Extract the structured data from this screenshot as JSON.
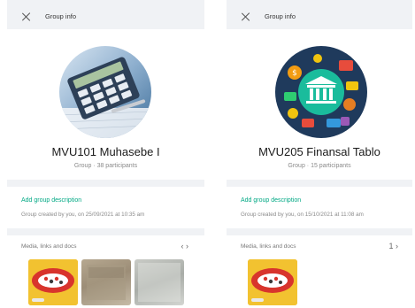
{
  "colors": {
    "accent": "#00a884",
    "panel_bg": "#f0f2f5",
    "card_bg": "#ffffff"
  },
  "panels": [
    {
      "header_title": "Group info",
      "group_name": "MVU101 Muhasebe I",
      "group_meta": "Group · 38 participants",
      "add_description": "Add group description",
      "created_by": "Group created by you, on 25/09/2021 at 10:35 am",
      "media_label": "Media, links and docs",
      "media_nav": "‹ ›",
      "icons": [
        "close-icon",
        "calculator-avatar"
      ]
    },
    {
      "header_title": "Group info",
      "group_name": "MVU205 Finansal Tablo",
      "group_meta": "Group · 15 participants",
      "add_description": "Add group description",
      "created_by": "Group created by you, on 15/10/2021 at 11:08 am",
      "media_label": "Media, links and docs",
      "media_nav": "1 ›",
      "icons": [
        "close-icon",
        "bank-finance-avatar"
      ]
    }
  ]
}
